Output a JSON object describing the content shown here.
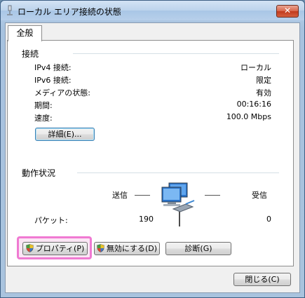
{
  "window": {
    "title": "ローカル エリア接続の状態",
    "close_label": "✕"
  },
  "tabs": [
    {
      "label": "全般"
    }
  ],
  "connection": {
    "section_title": "接続",
    "rows": [
      {
        "label": "IPv4 接続:",
        "value": "ローカル"
      },
      {
        "label": "IPv6 接続:",
        "value": "限定"
      },
      {
        "label": "メディアの状態:",
        "value": "有効"
      },
      {
        "label": "期間:",
        "value": "00:16:16"
      },
      {
        "label": "速度:",
        "value": "100.0 Mbps"
      }
    ],
    "details_button": "詳細(E)..."
  },
  "activity": {
    "section_title": "動作状況",
    "sent_label": "送信",
    "received_label": "受信",
    "packets_label": "パケット:",
    "packets_sent": "190",
    "packets_received": "0"
  },
  "actions": {
    "properties_button": "プロパティ(P)",
    "disable_button": "無効にする(D)",
    "diagnose_button": "診断(G)",
    "close_button": "閉じる(C)"
  },
  "colors": {
    "highlight": "#f07ad2",
    "close_button": "#c1391c"
  }
}
